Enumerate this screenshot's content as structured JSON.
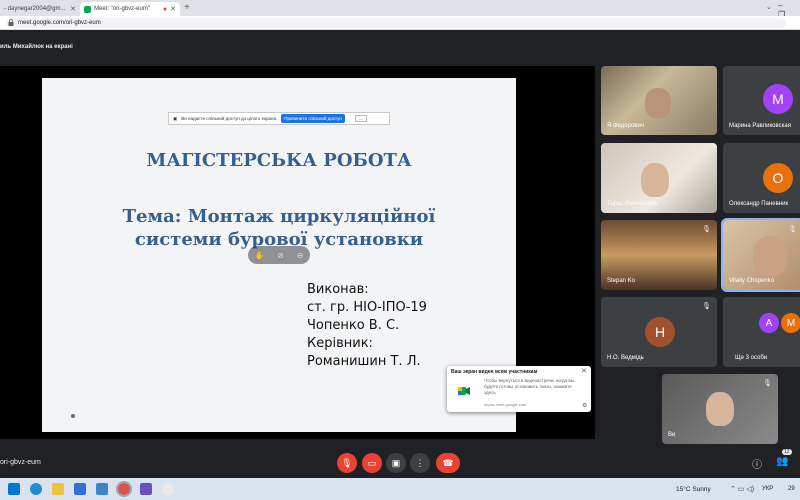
{
  "browser": {
    "tabs": [
      {
        "label": "- daynegar2004@gm...",
        "active": false
      },
      {
        "label": "Meet: \"ori-gbvz-eum\"",
        "active": true
      }
    ],
    "new_tab": "+",
    "url": "meet.google.com/ori-gbvz-eum"
  },
  "meet": {
    "presenting_banner": "иль Михайлюк на екрані",
    "share_bar": {
      "message": "Ви надаєте спільний доступ до цілого екрана.",
      "stop_label": "Припинити спільний доступ",
      "hide_label": "..."
    },
    "slide": {
      "title": "МАГІСТЕРСЬКА РОБОТА",
      "topic_line1": "Тема: Монтаж циркуляційної",
      "topic_line2": "системи бурової установки",
      "credits": [
        "Виконав:",
        "ст. гр. НІО-ІПО-19",
        "Чопенко В. С.",
        "Керівник:",
        "Романишин Т. Л."
      ]
    },
    "notification": {
      "title": "Ваш экран виден всем участникам",
      "body": "Чтобы вернуться в видеовстречи, когда вы будете готовы остановить показ, нажмите здесь",
      "source": "через meet.google.com",
      "close": "✕"
    },
    "participants": [
      {
        "name": "Я Федорович",
        "type": "video",
        "avatar": ""
      },
      {
        "name": "Марина Равликовская",
        "type": "avatar",
        "avatar": "M",
        "color": "#a142f4"
      },
      {
        "name": "Тарас Романишин",
        "type": "video",
        "avatar": ""
      },
      {
        "name": "Олександр Паневник",
        "type": "avatar",
        "avatar": "O",
        "color": "#e8710a"
      },
      {
        "name": "Stepan Ko",
        "type": "video",
        "avatar": ""
      },
      {
        "name": "Vitaliy Chopenko",
        "type": "video",
        "avatar": ""
      },
      {
        "name": "Н.О. Ведмідь",
        "type": "avatar",
        "avatar": "Н",
        "color": "#a0522d"
      },
      {
        "name": "Ще 3 особи",
        "type": "group",
        "avatars": [
          "A",
          "M"
        ]
      },
      {
        "name": "Ви",
        "type": "video",
        "avatar": ""
      }
    ],
    "meeting_code": "ori-gbvz-eum",
    "people_count": "12"
  },
  "taskbar": {
    "weather": "15°C  Sunny",
    "language": "УКР",
    "clock": "29"
  },
  "colors": {
    "slide_title": "#365f91",
    "danger": "#ea4335",
    "meet_bg": "#202124",
    "tile_bg": "#3c4043"
  }
}
